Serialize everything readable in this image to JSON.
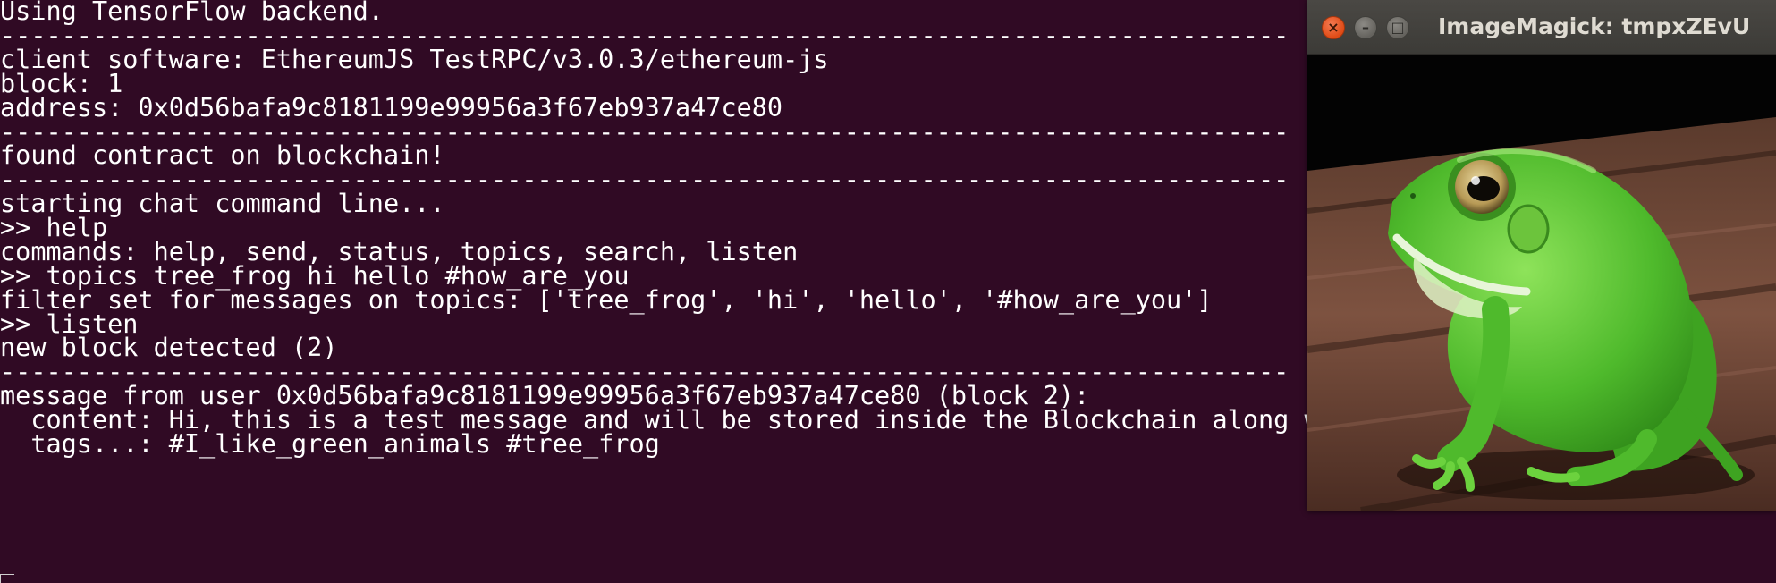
{
  "terminal": {
    "lines": [
      "Using TensorFlow backend.",
      "------------------------------------------------------------------------------------",
      "client software: EthereumJS TestRPC/v3.0.3/ethereum-js",
      "block: 1",
      "address: 0x0d56bafa9c8181199e99956a3f67eb937a47ce80",
      "------------------------------------------------------------------------------------",
      "found contract on blockchain!",
      "------------------------------------------------------------------------------------",
      "starting chat command line...",
      ">> help",
      "commands: help, send, status, topics, search, listen",
      ">> topics tree_frog hi hello #how_are_you",
      "filter set for messages on topics: ['tree_frog', 'hi', 'hello', '#how_are_you']",
      ">> listen",
      "new block detected (2)",
      "------------------------------------------------------------------------------------",
      "message from user 0x0d56bafa9c8181199e99956a3f67eb937a47ce80 (block 2):",
      "  content: Hi, this is a test message and will be stored inside the Blockchain along with a frog.",
      "  tags...: #I_like_green_animals #tree_frog"
    ]
  },
  "image_window": {
    "title": "ImageMagick: tmpxZEvU",
    "buttons": {
      "close": "×",
      "minimize": "–",
      "maximize": "□"
    },
    "image": "tree-frog-photo"
  },
  "colors": {
    "terminal_bg": "#300a24",
    "terminal_fg": "#ffffff",
    "titlebar": "#3c3b37",
    "close_button": "#df4b16",
    "frog_green": "#5cc33a"
  }
}
